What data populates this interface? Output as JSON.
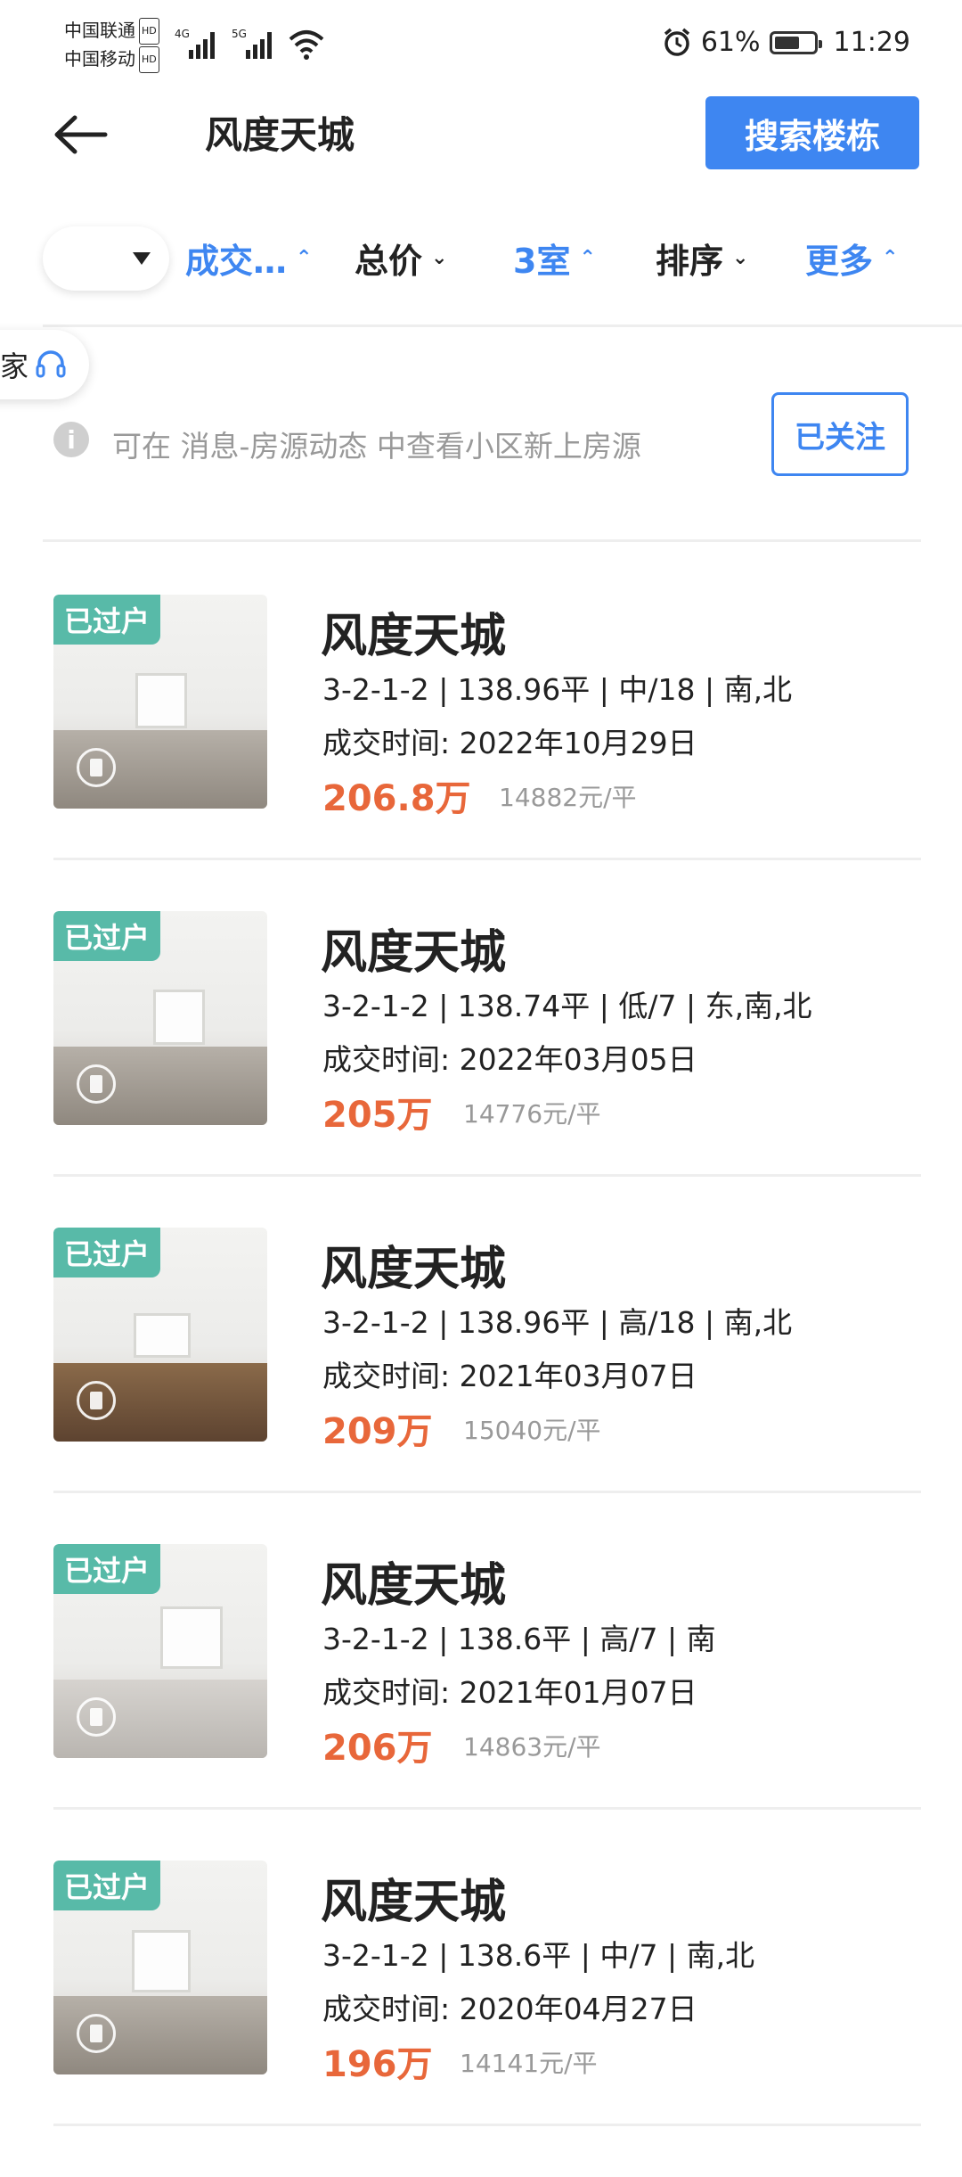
{
  "status_bar": {
    "carrier1": "中国联通",
    "carrier2": "中国移动",
    "hd_label": "HD",
    "net1": "4G",
    "net2": "5G",
    "battery": "61%",
    "time": "11:29"
  },
  "header": {
    "title": "风度天城",
    "search_button": "搜索楼栋"
  },
  "filters": {
    "f1": "成交…",
    "f2": "总价",
    "f3": "3室",
    "f4": "排序",
    "f5": "更多"
  },
  "side_tab": {
    "label": "家"
  },
  "notice": {
    "icon": "i",
    "text": "可在 消息-房源动态 中查看小区新上房源",
    "follow_button": "已关注"
  },
  "listings": [
    {
      "badge": "已过户",
      "title": "风度天城",
      "specs": "3-2-1-2 | 138.96平 | 中/18 | 南,北",
      "date": "成交时间: 2022年10月29日",
      "price": "206.8万",
      "unit_price": "14882元/平"
    },
    {
      "badge": "已过户",
      "title": "风度天城",
      "specs": "3-2-1-2 | 138.74平 | 低/7 | 东,南,北",
      "date": "成交时间: 2022年03月05日",
      "price": "205万",
      "unit_price": "14776元/平"
    },
    {
      "badge": "已过户",
      "title": "风度天城",
      "specs": "3-2-1-2 | 138.96平 | 高/18 | 南,北",
      "date": "成交时间: 2021年03月07日",
      "price": "209万",
      "unit_price": "15040元/平"
    },
    {
      "badge": "已过户",
      "title": "风度天城",
      "specs": "3-2-1-2 | 138.6平 | 高/7 | 南",
      "date": "成交时间: 2021年01月07日",
      "price": "206万",
      "unit_price": "14863元/平"
    },
    {
      "badge": "已过户",
      "title": "风度天城",
      "specs": "3-2-1-2 | 138.6平 | 中/7 | 南,北",
      "date": "成交时间: 2020年04月27日",
      "price": "196万",
      "unit_price": "14141元/平"
    }
  ],
  "colors": {
    "accent": "#3E86F1",
    "price": "#E8673A",
    "badge": "#58BAA8"
  }
}
